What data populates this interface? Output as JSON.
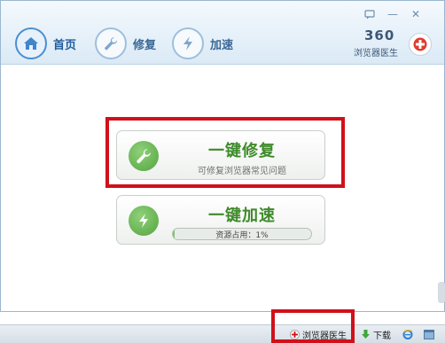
{
  "window": {
    "tabs": [
      {
        "label": "首页",
        "icon": "home-icon",
        "active": true
      },
      {
        "label": "修复",
        "icon": "wrench-icon",
        "active": false
      },
      {
        "label": "加速",
        "icon": "lightning-icon",
        "active": false
      }
    ],
    "controls": {
      "menu": "feedback-icon",
      "minimize": "—",
      "close": "✕"
    },
    "brand": {
      "number": "360",
      "name": "浏览器医生",
      "badge_icon": "red-cross-icon"
    }
  },
  "actions": {
    "repair": {
      "title": "一键修复",
      "subtitle": "可修复浏览器常见问题",
      "icon": "wrench-icon"
    },
    "speedup": {
      "title": "一键加速",
      "progress_text": "资源占用：1%",
      "progress_percent": 1,
      "icon": "lightning-icon"
    }
  },
  "taskbar": {
    "doctor_label": "浏览器医生",
    "download_label": "下载",
    "icons": [
      "plus-icon",
      "download-arrow-icon",
      "ie-icon",
      "window-icon"
    ]
  },
  "colors": {
    "accent_green": "#54a43e",
    "title_green": "#3e8a2a",
    "highlight_red": "#d0101b",
    "header_blue": "#dbeaf6"
  }
}
